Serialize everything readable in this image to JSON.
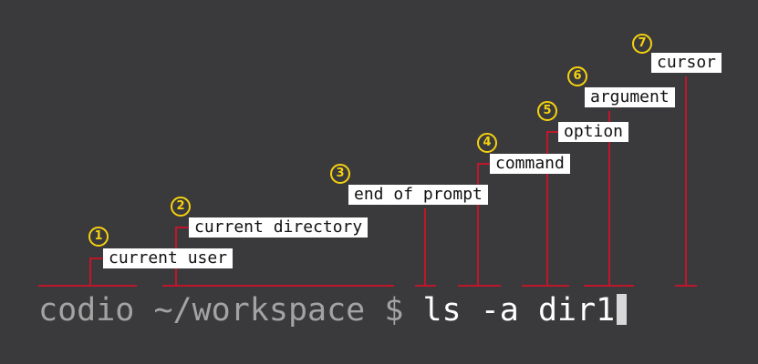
{
  "annotations": [
    {
      "number": "1",
      "label": "current user"
    },
    {
      "number": "2",
      "label": "current directory"
    },
    {
      "number": "3",
      "label": "end of prompt"
    },
    {
      "number": "4",
      "label": "command"
    },
    {
      "number": "5",
      "label": "option"
    },
    {
      "number": "6",
      "label": "argument"
    },
    {
      "number": "7",
      "label": "cursor"
    }
  ],
  "prompt": {
    "user": "codio",
    "directory": "~/workspace",
    "end": "$",
    "command": "ls",
    "option": "-a",
    "argument": "dir1"
  },
  "colors": {
    "background": "#3a3a3c",
    "leader": "#c0162c",
    "number": "#f5d10f",
    "prompt_text": "#a3a3a3",
    "input_text": "#ffffff"
  }
}
